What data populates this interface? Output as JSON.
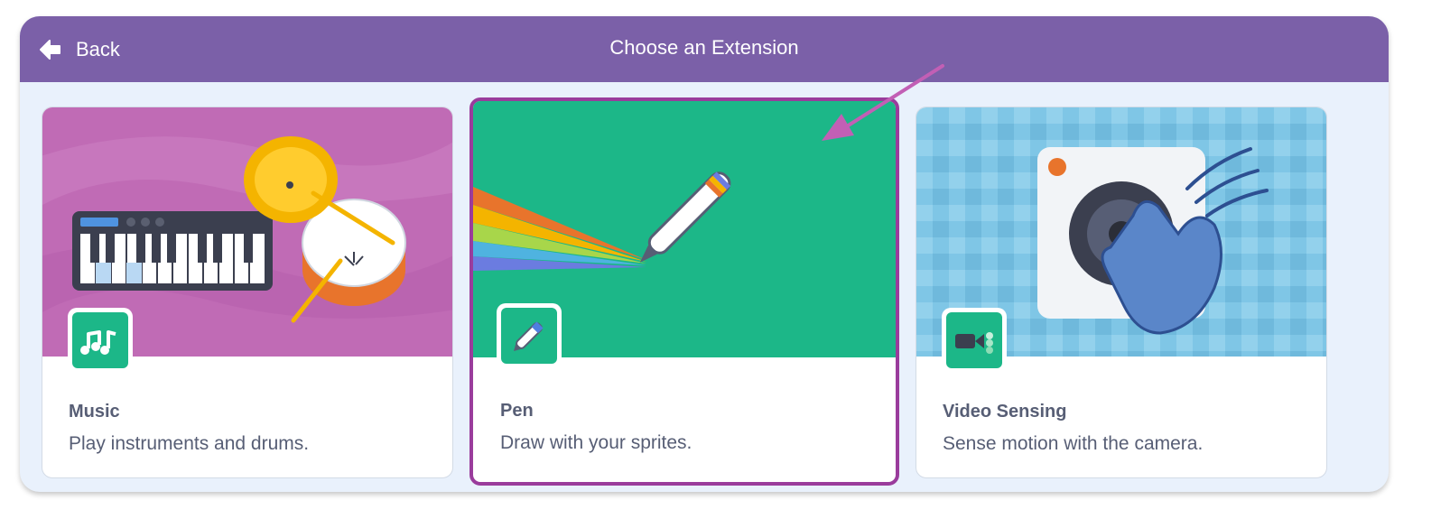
{
  "header": {
    "back_label": "Back",
    "title": "Choose an Extension",
    "background": "#7b60a8"
  },
  "extensions": [
    {
      "name": "Music",
      "description": "Play instruments and drums.",
      "icon": "music-notes-icon",
      "art_color": "#c06bb5"
    },
    {
      "name": "Pen",
      "description": "Draw with your sprites.",
      "icon": "pen-icon",
      "art_color": "#1cb788",
      "selected": true
    },
    {
      "name": "Video Sensing",
      "description": "Sense motion with the camera.",
      "icon": "video-camera-icon",
      "art_color": "#7fc6e6"
    }
  ],
  "annotation": {
    "color": "#c25fb5",
    "icon": "pointer-arrow"
  }
}
